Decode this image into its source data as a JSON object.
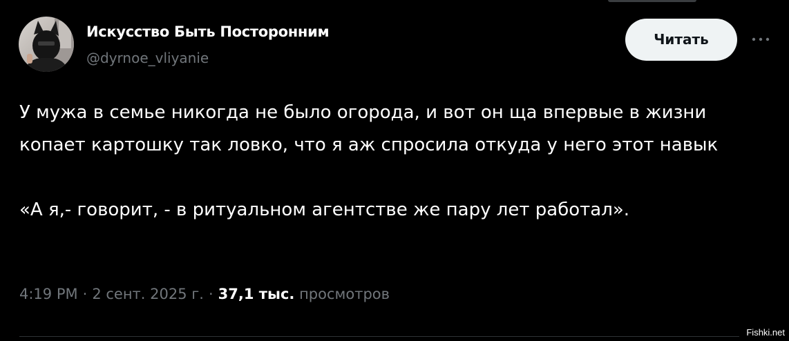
{
  "author": {
    "name": "Искусство Быть Посторонним",
    "handle": "@dyrnoe_vliyanie"
  },
  "actions": {
    "read_label": "Читать",
    "more_icon": "more-horizontal-icon"
  },
  "tweet": {
    "paragraph_1": "У мужа в семье никогда не было огорода, и вот он ща впервые в жизни копает картошку так ловко, что я аж спросила откуда у него этот навык",
    "paragraph_2": "«А я,- говорит, - в ритуальном агентстве же пару лет работал»."
  },
  "meta": {
    "time": "4:19 PM",
    "date": "2 сент. 2025 г.",
    "views_count": "37,1 тыс.",
    "views_label": "просмотров"
  },
  "watermark": "Fishki.net",
  "colors": {
    "background": "#000000",
    "text": "#ffffff",
    "secondary": "#71767b",
    "button_bg": "#eff3f4",
    "button_text": "#0f1419"
  }
}
